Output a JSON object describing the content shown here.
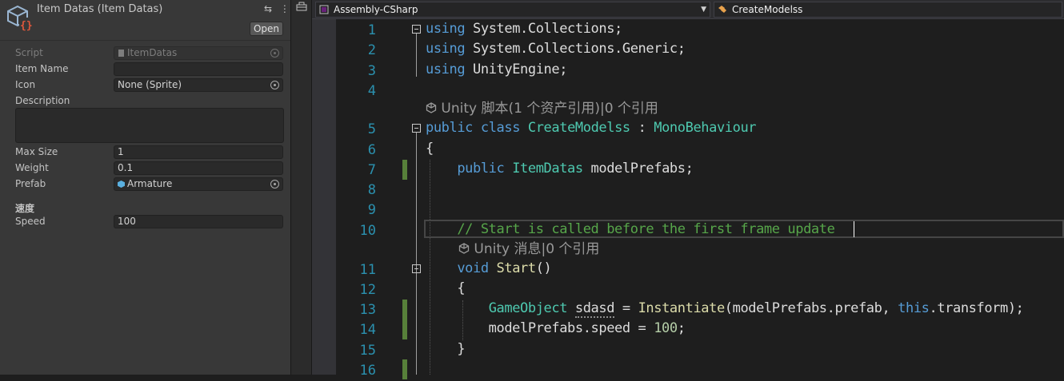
{
  "inspector": {
    "title": "Item Datas (Item Datas)",
    "open_button": "Open",
    "fields": {
      "script": {
        "label": "Script",
        "value": "ItemDatas"
      },
      "item_name": {
        "label": "Item Name",
        "value": ""
      },
      "icon": {
        "label": "Icon",
        "value": "None (Sprite)"
      },
      "description": {
        "label": "Description"
      },
      "max_size": {
        "label": "Max Size",
        "value": "1"
      },
      "weight": {
        "label": "Weight",
        "value": "0.1"
      },
      "prefab": {
        "label": "Prefab",
        "value": "Armature"
      }
    },
    "section_header": "速度",
    "speed": {
      "label": "Speed",
      "value": "100"
    }
  },
  "editor": {
    "project_combo": "Assembly-CSharp",
    "class_combo": "CreateModelss",
    "line_numbers": [
      "1",
      "2",
      "3",
      "4",
      "5",
      "6",
      "7",
      "8",
      "9",
      "10",
      "11",
      "12",
      "13",
      "14",
      "15",
      "16"
    ],
    "codelens_class": "Unity 脚本(1 个资产引用)|0 个引用",
    "codelens_start": "Unity 消息|0 个引用"
  },
  "colors": {
    "keyword": "#569cd6",
    "type": "#4ec9b0",
    "method": "#dcdcaa",
    "comment": "#57a64a",
    "number": "#b5cea8",
    "line_number": "#2b91af",
    "change_marker": "#57803a"
  }
}
